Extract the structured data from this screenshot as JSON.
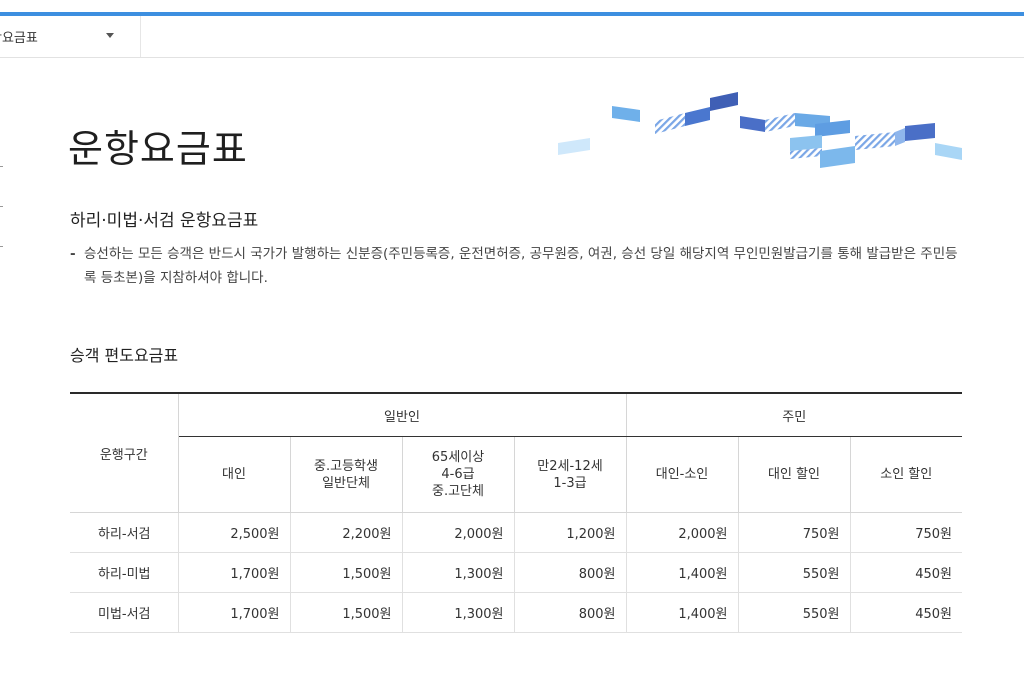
{
  "subnav": {
    "selected": "항요금표"
  },
  "page": {
    "title": "운항요금표"
  },
  "section": {
    "title": "하리·미법·서검 운항요금표",
    "notice": "승선하는 모든 승객은 반드시 국가가 발행하는 신분증(주민등록증, 운전면허증, 공무원증, 여권, 승선 당일 해당지역 무인민원발급기를 통해 발급받은 주민등록 등초본)을 지참하셔야 합니다."
  },
  "table": {
    "title": "승객 편도요금표",
    "route_header": "운행구간",
    "groups": [
      "일반인",
      "주민"
    ],
    "columns": [
      [
        "대인"
      ],
      [
        "중.고등학생",
        "일반단체"
      ],
      [
        "65세이상",
        "4-6급",
        "중.고단체"
      ],
      [
        "만2세-12세",
        "1-3급"
      ],
      [
        "대인-소인"
      ],
      [
        "대인 할인"
      ],
      [
        "소인 할인"
      ]
    ],
    "rows": [
      {
        "route": "하리-서검",
        "fares": [
          "2,500원",
          "2,200원",
          "2,000원",
          "1,200원",
          "2,000원",
          "750원",
          "750원"
        ]
      },
      {
        "route": "하리-미법",
        "fares": [
          "1,700원",
          "1,500원",
          "1,300원",
          "800원",
          "1,400원",
          "550원",
          "450원"
        ]
      },
      {
        "route": "미법-서검",
        "fares": [
          "1,700원",
          "1,500원",
          "1,300원",
          "800원",
          "1,400원",
          "550원",
          "450원"
        ]
      }
    ]
  },
  "colors": {
    "accent": "#3d8fe0",
    "deco_dark": "#3f5fb5",
    "deco_light": "#7fb7ea"
  }
}
